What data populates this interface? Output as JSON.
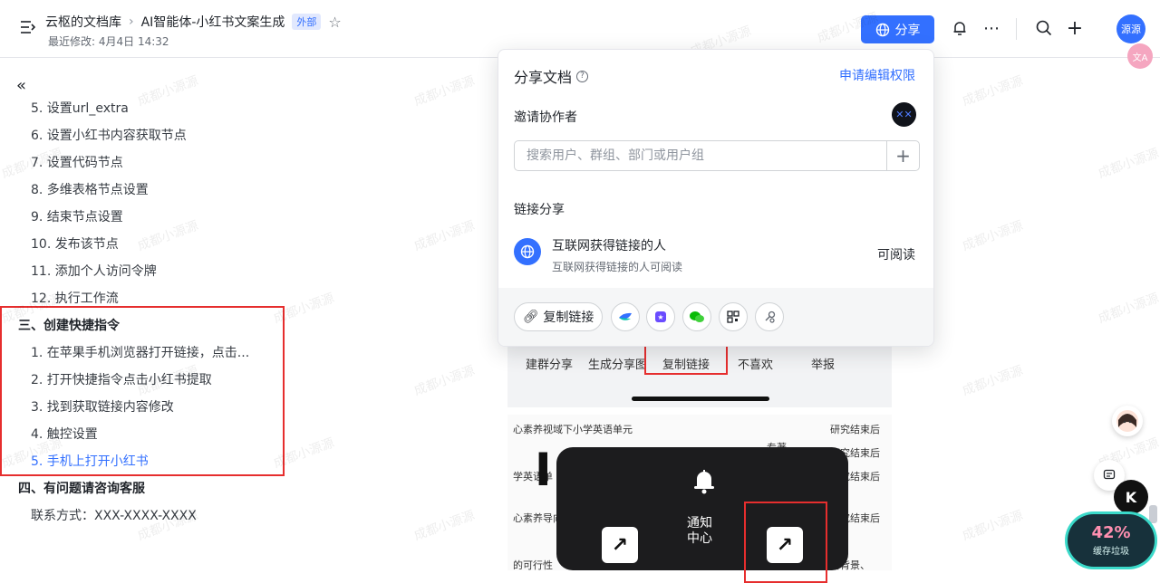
{
  "header": {
    "breadcrumb": [
      "云枢的文档库",
      "AI智能体-小红书文案生成"
    ],
    "tag": "外部",
    "last_modified": "最近修改: 4月4日 14:32",
    "share_label": "分享",
    "avatar_text": "源源",
    "translate_badge": "文A"
  },
  "toc": {
    "items": [
      {
        "level": 2,
        "label": "5. 设置url_extra"
      },
      {
        "level": 2,
        "label": "6. 设置小红书内容获取节点"
      },
      {
        "level": 2,
        "label": "7. 设置代码节点"
      },
      {
        "level": 2,
        "label": "8. 多维表格节点设置"
      },
      {
        "level": 2,
        "label": "9. 结束节点设置"
      },
      {
        "level": 2,
        "label": "10. 发布该节点"
      },
      {
        "level": 2,
        "label": "11. 添加个人访问令牌"
      },
      {
        "level": 2,
        "label": "12. 执行工作流"
      },
      {
        "level": 1,
        "label": "三、创建快捷指令"
      },
      {
        "level": 2,
        "label": "1. 在苹果手机浏览器打开链接，点击..."
      },
      {
        "level": 2,
        "label": "2. 打开快捷指令点击小红书提取"
      },
      {
        "level": 2,
        "label": "3. 找到获取链接内容修改"
      },
      {
        "level": 2,
        "label": "4. 触控设置"
      },
      {
        "level": 2,
        "label": "5. 手机上打开小红书",
        "active": true
      },
      {
        "level": 1,
        "label": "四、有问题请咨询客服"
      },
      {
        "level": 2,
        "label": "联系方式：XXX-XXXX-XXXX"
      }
    ]
  },
  "watermark": "成都小源源",
  "share_popup": {
    "title": "分享文档",
    "request_link": "申请编辑权限",
    "invite_label": "邀请协作者",
    "search_placeholder": "搜索用户、群组、部门或用户组",
    "link_share_label": "链接分享",
    "permission_title": "互联网获得链接的人",
    "permission_subtitle": "互联网获得链接的人可阅读",
    "permission_level": "可阅读",
    "copy_link_label": "复制链接"
  },
  "doc_image1": {
    "labels": [
      "建群分享",
      "生成分享图",
      "复制链接",
      "不喜欢",
      "举报"
    ]
  },
  "doc_image2": {
    "rows": [
      "心素养视域下小学英语单元",
      "学英语单",
      "心素养导向",
      "的可行性"
    ],
    "right_rows": [
      "研究结束后",
      "研究结束后",
      "研究结束后",
      "研究结束后",
      "科背景、"
    ],
    "middle_text": "专著",
    "notif_label_line1": "通知",
    "notif_label_line2": "中心"
  },
  "widgets": {
    "cache_percent": "42%",
    "cache_label": "缓存垃圾"
  },
  "colors": {
    "accent": "#3370ff",
    "highlight_red": "#e62e2e"
  }
}
